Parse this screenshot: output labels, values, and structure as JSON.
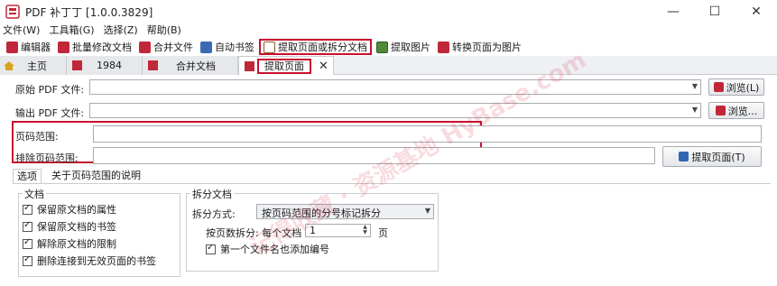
{
  "window": {
    "title": "PDF 补丁丁 [1.0.0.3829]",
    "minimize_glyph": "—",
    "maximize_glyph": "☐",
    "close_glyph": "✕"
  },
  "menu": [
    "文件(W)",
    "工具箱(G)",
    "选择(Z)",
    "帮助(B)"
  ],
  "toolbar": [
    {
      "label": "编辑器",
      "icon": "editor-icon"
    },
    {
      "label": "批量修改文档",
      "icon": "batch-edit-icon"
    },
    {
      "label": "合并文件",
      "icon": "merge-icon"
    },
    {
      "label": "自动书签",
      "icon": "bookmark-icon"
    },
    {
      "label": "提取页面或拆分文档",
      "icon": "extract-pages-icon"
    },
    {
      "label": "提取图片",
      "icon": "extract-images-icon"
    },
    {
      "label": "转换页面为图片",
      "icon": "convert-to-image-icon"
    }
  ],
  "tabs": [
    {
      "label": "主页",
      "icon": "home-icon"
    },
    {
      "label": "1984",
      "icon": "pdf-icon"
    },
    {
      "label": "合并文档",
      "icon": "pdf-icon"
    },
    {
      "label": "提取页面",
      "icon": "pdf-icon"
    }
  ],
  "form": {
    "source_label": "原始 PDF 文件:",
    "output_label": "输出 PDF 文件:",
    "browse_label": "浏览(L)",
    "browse2_label": "浏览...",
    "page_range_label": "页码范围:",
    "exclude_range_label": "排除页码范围:",
    "extract_button": "提取页面(T)"
  },
  "options_tabs": [
    "选项",
    "关于页码范围的说明"
  ],
  "doc_group": {
    "title": "文档",
    "items": [
      "保留原文档的属性",
      "保留原文档的书签",
      "解除原文档的限制",
      "删除连接到无效页面的书签"
    ]
  },
  "split_group": {
    "title": "拆分文档",
    "method_label": "拆分方式:",
    "method_value": "按页码范围的分号标记拆分",
    "per_page_label": "按页数拆分: 每个文档",
    "per_page_value": "1",
    "per_page_unit": "页",
    "first_file_label": "第一个文件名也添加编号"
  },
  "watermark": "记得收藏 · 资源基地  HyBase.com",
  "colors": {
    "highlight": "#c8102e",
    "app_red": "#c0283a"
  }
}
